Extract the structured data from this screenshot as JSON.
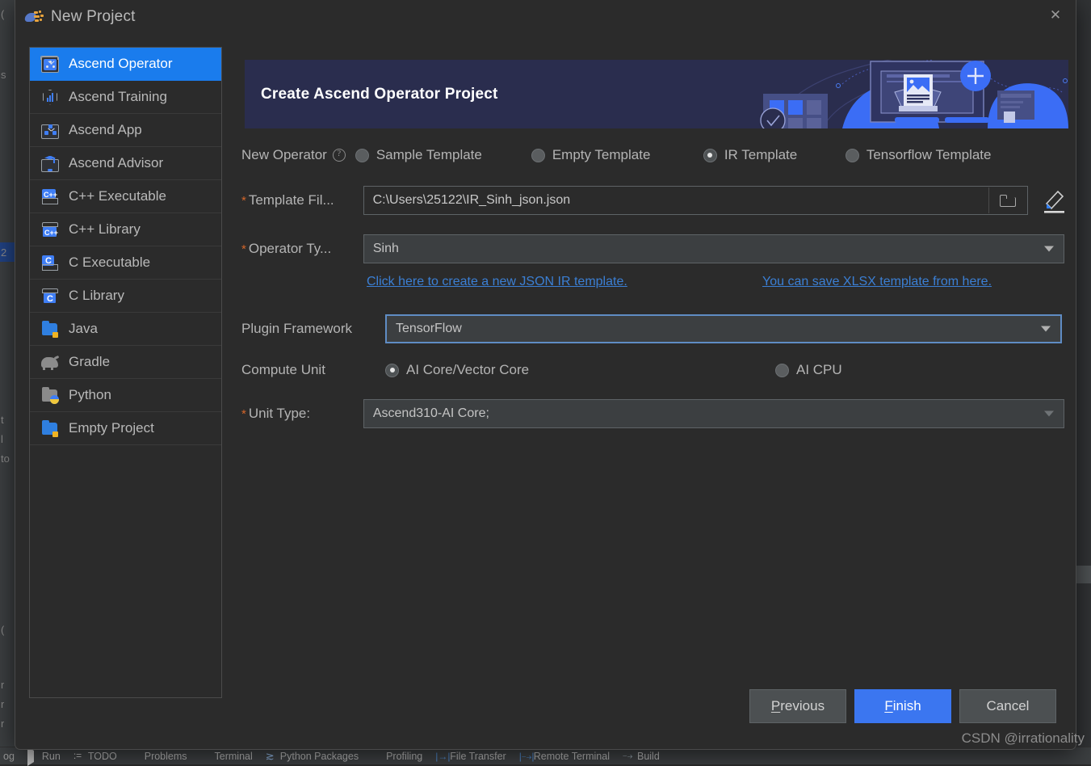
{
  "window": {
    "title": "New Project",
    "app_icon": "intellij-new-project-icon",
    "close_label": "✕"
  },
  "sidebar": {
    "items": [
      {
        "label": "Ascend Operator",
        "icon": "ascend-operator-icon",
        "selected": true
      },
      {
        "label": "Ascend Training",
        "icon": "ascend-training-icon",
        "selected": false
      },
      {
        "label": "Ascend App",
        "icon": "ascend-app-icon",
        "selected": false
      },
      {
        "label": "Ascend Advisor",
        "icon": "ascend-advisor-icon",
        "selected": false
      },
      {
        "label": "C++ Executable",
        "icon": "cpp-executable-icon",
        "selected": false
      },
      {
        "label": "C++ Library",
        "icon": "cpp-library-icon",
        "selected": false
      },
      {
        "label": "C Executable",
        "icon": "c-executable-icon",
        "selected": false
      },
      {
        "label": "C Library",
        "icon": "c-library-icon",
        "selected": false
      },
      {
        "label": "Java",
        "icon": "java-folder-icon",
        "selected": false
      },
      {
        "label": "Gradle",
        "icon": "gradle-elephant-icon",
        "selected": false
      },
      {
        "label": "Python",
        "icon": "python-folder-icon",
        "selected": false
      },
      {
        "label": "Empty Project",
        "icon": "empty-project-folder-icon",
        "selected": false
      }
    ]
  },
  "banner": {
    "title": "Create Ascend Operator Project"
  },
  "form": {
    "new_operator": {
      "label": "New Operator",
      "help_icon": "help-question-icon",
      "options": [
        {
          "label": "Sample Template",
          "selected": false
        },
        {
          "label": "Empty Template",
          "selected": false
        },
        {
          "label": "IR Template",
          "selected": true
        },
        {
          "label": "Tensorflow Template",
          "selected": false
        }
      ]
    },
    "template_file": {
      "label": "Template Fil...",
      "required": true,
      "value": "C:\\Users\\25122\\IR_Sinh_json.json",
      "browse_icon": "folder-browse-icon",
      "edit_icon": "pencil-edit-icon"
    },
    "operator_type": {
      "label": "Operator Ty...",
      "required": true,
      "value": "Sinh"
    },
    "links": [
      {
        "label": "Click here to create a new JSON IR template."
      },
      {
        "label": "You can save XLSX template from here."
      }
    ],
    "plugin_framework": {
      "label": "Plugin Framework",
      "required": false,
      "value": "TensorFlow",
      "focused": true
    },
    "compute_unit": {
      "label": "Compute Unit",
      "options": [
        {
          "label": "AI Core/Vector Core",
          "selected": true
        },
        {
          "label": "AI CPU",
          "selected": false
        }
      ]
    },
    "unit_type": {
      "label": "Unit Type:",
      "required": true,
      "value": "Ascend310-AI Core;"
    }
  },
  "footer": {
    "previous": "Previous",
    "previous_mnemonic": "P",
    "finish": "Finish",
    "finish_mnemonic": "F",
    "cancel": "Cancel"
  },
  "statusbar": {
    "items": [
      {
        "label": "Run",
        "icon": "run-play-icon"
      },
      {
        "label": "TODO",
        "icon": "todo-list-icon"
      },
      {
        "label": "Problems",
        "icon": "problems-shield-icon"
      },
      {
        "label": "Terminal",
        "icon": "terminal-icon"
      },
      {
        "label": "Python Packages",
        "icon": "python-packages-icon"
      },
      {
        "label": "Profiling",
        "icon": "profiling-icon"
      },
      {
        "label": "File Transfer",
        "icon": "file-transfer-icon"
      },
      {
        "label": "Remote Terminal",
        "icon": "remote-terminal-icon"
      },
      {
        "label": "Build",
        "icon": "build-hammer-icon"
      }
    ],
    "leading_label": "og"
  },
  "watermark": "CSDN @irrationality",
  "colors": {
    "accent_blue": "#1a7ced",
    "banner_bg": "#2a2d4e",
    "dialog_bg": "#2b2b2b",
    "link_blue": "#3b7fd4",
    "required_orange": "#d4662a",
    "focus_border": "#5f8cc4",
    "finish_button": "#3b76f0"
  }
}
